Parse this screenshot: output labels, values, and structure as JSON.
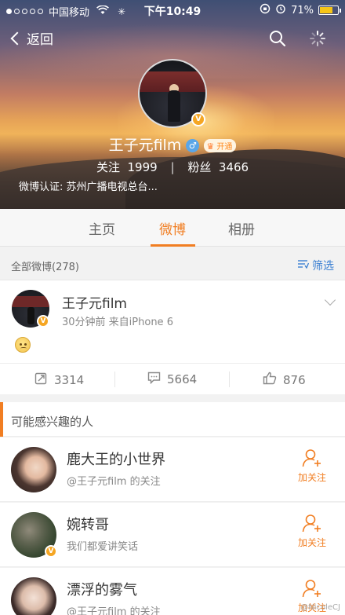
{
  "status_bar": {
    "carrier": "中国移动",
    "time": "下午10:49",
    "battery": "71%",
    "battery_level": 0.71
  },
  "nav": {
    "back_label": "返回"
  },
  "profile": {
    "name": "王子元film",
    "vip_label": "开通",
    "following_label": "关注",
    "following_count": "1999",
    "followers_label": "粉丝",
    "followers_count": "3466",
    "verification": "微博认证:  苏州广播电视总台..."
  },
  "tabs": [
    {
      "label": "主页"
    },
    {
      "label": "微博"
    },
    {
      "label": "相册"
    }
  ],
  "feed": {
    "count_label": "全部微博(278)",
    "filter_label": "筛选"
  },
  "post": {
    "author": "王子元film",
    "meta": "30分钟前  来自iPhone 6",
    "reposts": "3314",
    "comments": "5664",
    "likes": "876"
  },
  "suggestions": {
    "title": "可能感兴趣的人",
    "follow_label": "加关注",
    "people": [
      {
        "name": "鹿大王的小世界",
        "sub": "@王子元film 的关注"
      },
      {
        "name": "婉转哥",
        "sub": "我们都爱讲笑话"
      },
      {
        "name": "漂浮的雾气",
        "sub": "@王子元film 的关注"
      }
    ]
  },
  "watermark": "@NicoleCJ",
  "colors": {
    "accent": "#f17e22",
    "link": "#3a7fd2"
  }
}
